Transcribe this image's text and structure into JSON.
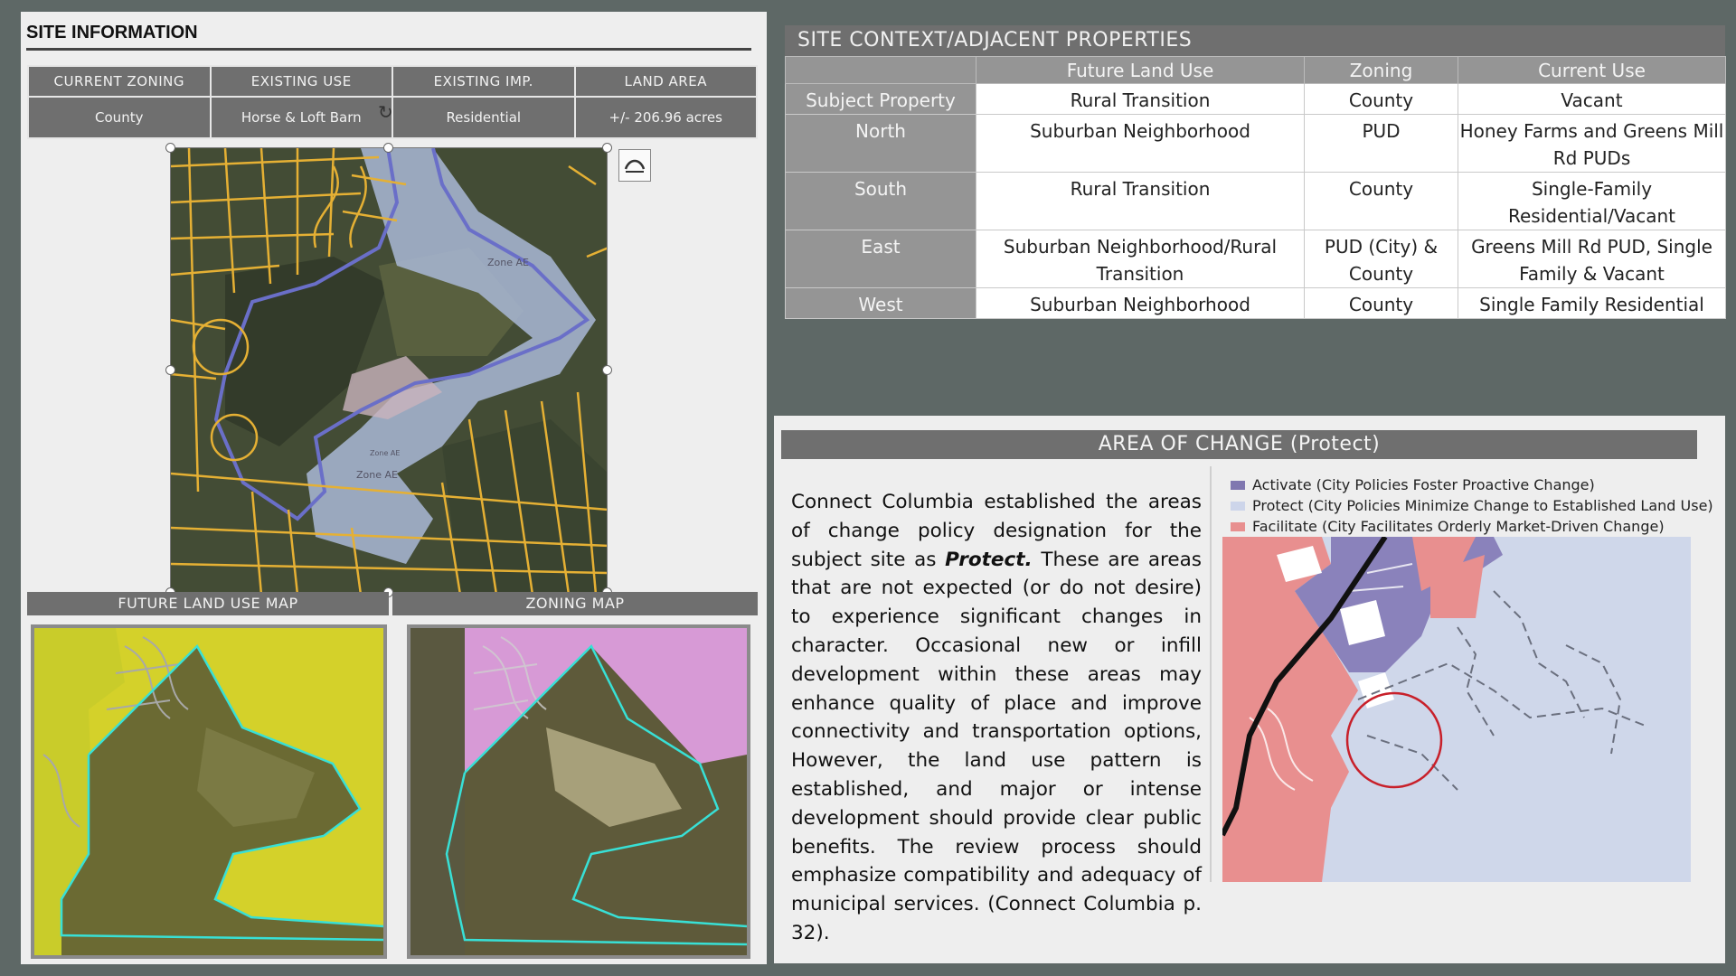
{
  "site_information": {
    "title": "SITE INFORMATION",
    "headers": [
      "CURRENT ZONING",
      "EXISTING USE",
      "EXISTING IMP.",
      "LAND AREA"
    ],
    "values": [
      "County",
      "Horse & Loft Barn",
      "Residential",
      "+/- 206.96 acres"
    ]
  },
  "maps": {
    "aerial_zone_labels": [
      "Zone AE",
      "Zone AE",
      "Zone AE"
    ],
    "future_land_use_caption": "FUTURE LAND USE MAP",
    "zoning_caption": "ZONING MAP"
  },
  "context": {
    "title": "SITE CONTEXT/ADJACENT PROPERTIES",
    "headers": [
      "",
      "Future Land Use",
      "Zoning",
      "Current Use"
    ],
    "rows": [
      {
        "label": "Subject Property",
        "future_land_use": "Rural Transition",
        "zoning": "County",
        "current_use": "Vacant"
      },
      {
        "label": "North",
        "future_land_use": "Suburban Neighborhood",
        "zoning": "PUD",
        "current_use": "Honey Farms and Greens Mill Rd PUDs"
      },
      {
        "label": "South",
        "future_land_use": "Rural Transition",
        "zoning": "County",
        "current_use": "Single-Family Residential/Vacant"
      },
      {
        "label": "East",
        "future_land_use": "Suburban Neighborhood/Rural Transition",
        "zoning": "PUD (City) & County",
        "current_use": "Greens Mill Rd PUD, Single Family & Vacant"
      },
      {
        "label": "West",
        "future_land_use": "Suburban Neighborhood",
        "zoning": "County",
        "current_use": "Single Family Residential"
      }
    ]
  },
  "area_of_change": {
    "title": "AREA OF CHANGE (Protect)",
    "text_before": "Connect Columbia established the areas of change policy designation for the subject site as ",
    "text_emphasis": "Protect.",
    "text_after": " These are areas that are not expected (or do not desire) to experience significant changes in character. Occasional new or infill development within these areas may enhance quality of place and improve connectivity and transportation options, However, the land use pattern is established, and major or intense development should provide clear public benefits. The review process should emphasize compatibility and adequacy of municipal services. (Connect Columbia p. 32).",
    "legend": [
      {
        "label": "Activate (City Policies Foster Proactive Change)",
        "color": "#8077b0"
      },
      {
        "label": "Protect (City Policies Minimize Change to Established Land Use)",
        "color": "#cdd5ea"
      },
      {
        "label": "Facilitate (City Facilitates Orderly Market-Driven Change)",
        "color": "#e88f8f"
      }
    ]
  },
  "colors": {
    "background": "#5e6866",
    "header_gray": "#6f6f6f",
    "road_yellow": "#e5b034",
    "boundary_blue": "#6a6fc8",
    "flood_zone": "#a9b9d6",
    "flu_yellow": "#d4d12a",
    "zoning_pink": "#d79ad6",
    "parcel_cyan": "#38e0d6",
    "circle_red": "#c8202a"
  }
}
